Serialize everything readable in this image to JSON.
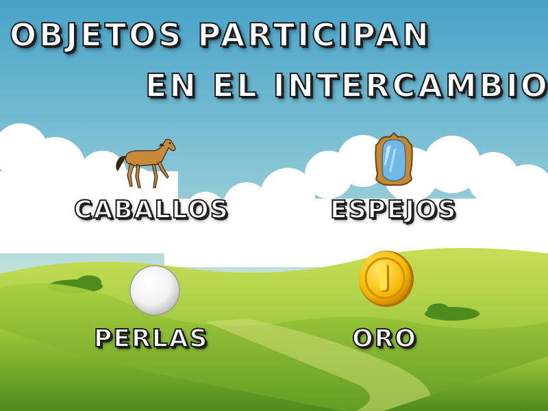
{
  "title": {
    "line1": "OBJETOS PARTICIPAN",
    "line2": "EN EL INTERCAMBIO"
  },
  "items": [
    {
      "label": "CABALLOS",
      "icon": "horse-icon"
    },
    {
      "label": "ESPEJOS",
      "icon": "mirror-icon"
    },
    {
      "label": "PERLAS",
      "icon": "pearl-icon"
    },
    {
      "label": "ORO",
      "icon": "gold-coin-icon"
    }
  ],
  "colors": {
    "sky_top": "#4aa6c8",
    "sky_bottom": "#cfe8d9",
    "hill_light": "#b9d94a",
    "hill_dark": "#6fa62a",
    "label_fill": "#ffffff",
    "label_outline": "#1a1a1a"
  }
}
